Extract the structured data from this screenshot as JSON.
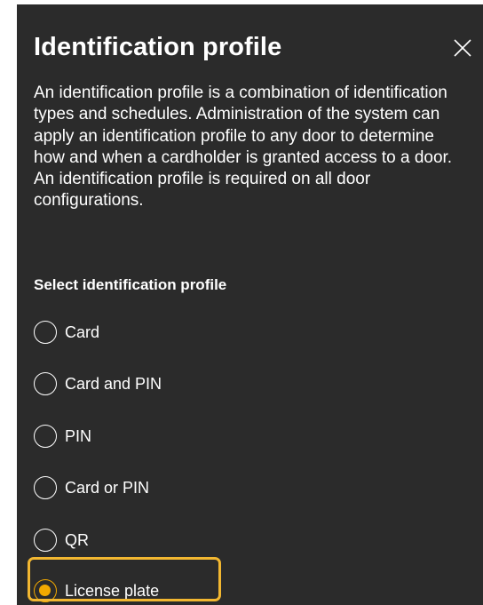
{
  "dialog": {
    "title": "Identification profile",
    "close_icon": "close-icon",
    "description": "An identification profile is a combination of identification types and schedules. Administration of the system can apply an identification profile to any door to determine how and when a cardholder is granted access to a door. An identification profile is required on all door configurations.",
    "section_label": "Select identification profile",
    "options": [
      {
        "label": "Card",
        "selected": false
      },
      {
        "label": "Card and PIN",
        "selected": false
      },
      {
        "label": "PIN",
        "selected": false
      },
      {
        "label": "Card or PIN",
        "selected": false
      },
      {
        "label": "QR",
        "selected": false
      },
      {
        "label": "License plate",
        "selected": true
      }
    ]
  },
  "colors": {
    "panel_background": "#2b2b2b",
    "text": "#ffffff",
    "accent": "#f2a900",
    "highlight_outline": "#f2b731"
  }
}
